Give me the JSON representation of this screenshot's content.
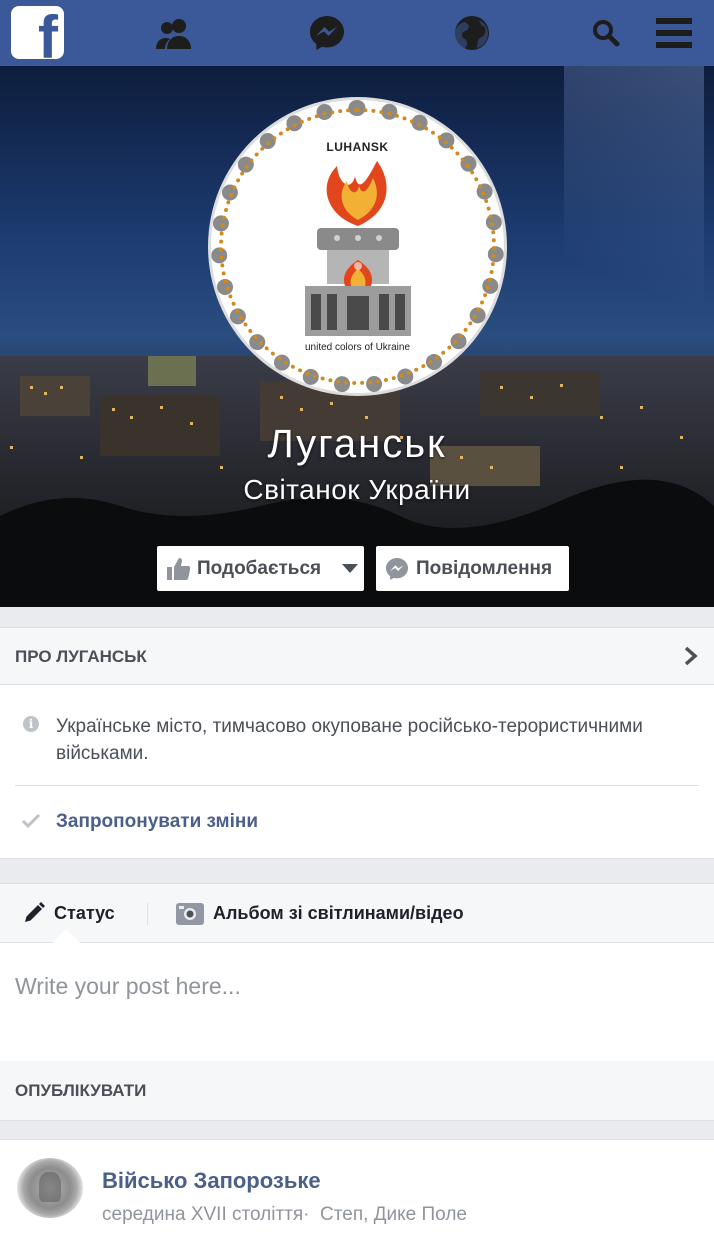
{
  "topbar": {
    "logo": "f",
    "icons": [
      "friends-icon",
      "messenger-icon",
      "globe-icon",
      "search-icon",
      "menu-icon"
    ]
  },
  "cover": {
    "seal_top": "LUHANSK",
    "seal_bottom": "united colors of Ukraine",
    "title": "Луганськ",
    "subtitle": "Світанок України"
  },
  "actions": {
    "like_label": "Подобається",
    "message_label": "Повідомлення"
  },
  "about": {
    "header": "ПРО ЛУГАНСЬК",
    "description": "Українське місто, тимчасово окуповане російсько-терористичними військами.",
    "suggest_label": "Запропонувати зміни"
  },
  "composer": {
    "tab_status": "Статус",
    "tab_album": "Альбом зі світлинами/відео",
    "placeholder": "Write your post here...",
    "publish_label": "ОПУБЛІКУВАТИ"
  },
  "post": {
    "author": "Військо Запорозьке",
    "time": "середина XVII століття",
    "separator": "·",
    "location": "Степ, Дике Поле"
  },
  "colors": {
    "brand": "#3b5998",
    "link": "#4b5f8a",
    "background": "#e9ebee"
  }
}
